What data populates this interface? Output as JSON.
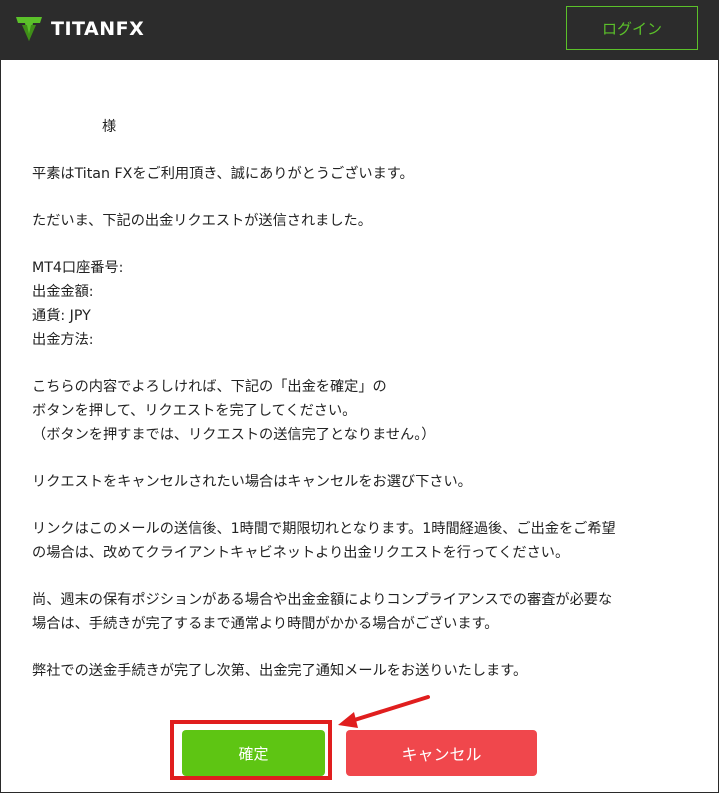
{
  "header": {
    "brand": "TITANFX",
    "brand_main": "TITAN",
    "brand_fx": "FX",
    "login_label": "ログイン",
    "background": "#2c2c2c",
    "accent": "#5bc12a"
  },
  "message": {
    "greeting_suffix": "様",
    "line1": "平素はTitan FXをご利用頂き、誠にありがとうございます。",
    "line2": "ただいま、下記の出金リクエストが送信されました。",
    "account_label": "MT4口座番号:",
    "amount_label": "出金金額:",
    "currency_label": "通貨: JPY",
    "method_label": "出金方法:",
    "confirm_instruction_1": "こちらの内容でよろしければ、下記の「出金を確定」の",
    "confirm_instruction_2": "ボタンを押して、リクエストを完了してください。",
    "confirm_instruction_3": "（ボタンを押すまでは、リクエストの送信完了となりません。）",
    "cancel_note": "リクエストをキャンセルされたい場合はキャンセルをお選び下さい。",
    "expiry_note_1": "リンクはこのメールの送信後、1時間で期限切れとなります。1時間経過後、ご出金をご希望",
    "expiry_note_2": "の場合は、改めてクライアントキャビネットより出金リクエストを行ってください。",
    "review_note_1": "尚、週末の保有ポジションがある場合や出金金額によりコンプライアンスでの審査が必要な",
    "review_note_2": "場合は、手続きが完了するまで通常より時間がかかる場合がございます。",
    "final_note": "弊社での送金手続きが完了し次第、出金完了通知メールをお送りいたします。"
  },
  "actions": {
    "confirm_label": "確定",
    "cancel_label": "キャンセル",
    "confirm_color": "#5ec513",
    "cancel_color": "#f0474c",
    "highlight_color": "#e01e1e"
  }
}
